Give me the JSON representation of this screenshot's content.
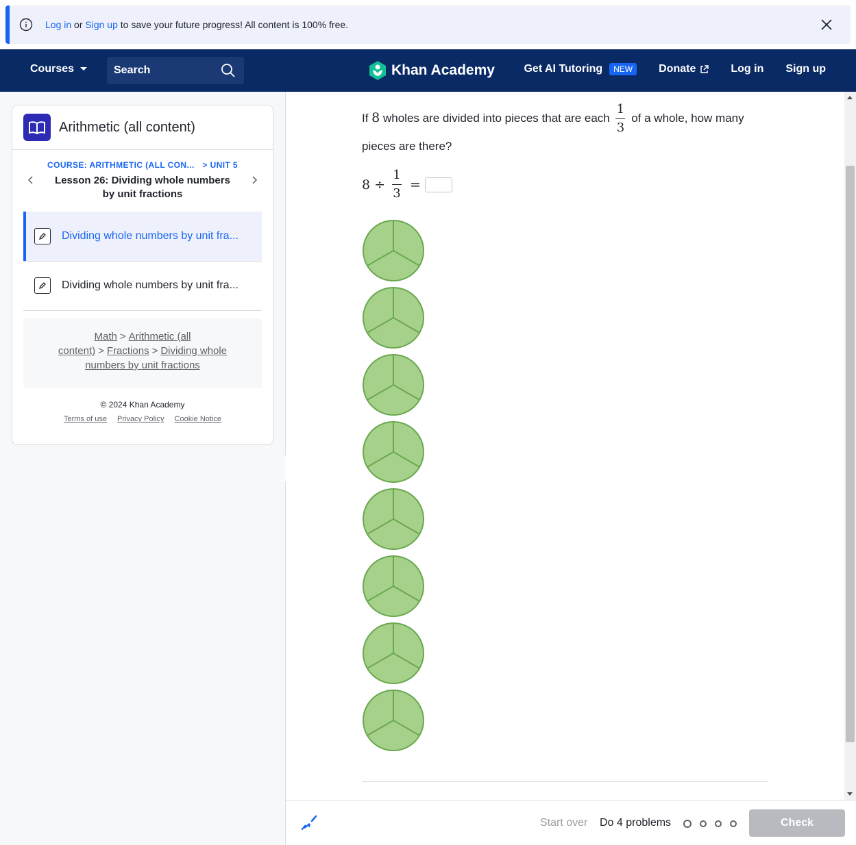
{
  "banner": {
    "login_link": "Log in",
    "or_text": " or ",
    "signup_link": "Sign up",
    "message": " to save your future progress! All content is 100% free."
  },
  "header": {
    "courses_label": "Courses",
    "search_placeholder": "Search",
    "logo_text": "Khan Academy",
    "ai_tutoring_label": "Get AI Tutoring",
    "new_badge": "NEW",
    "donate_label": "Donate",
    "login_label": "Log in",
    "signup_label": "Sign up"
  },
  "sidebar": {
    "course_title": "Arithmetic (all content)",
    "lesson_crumb_course": "COURSE: ARITHMETIC (ALL CON...",
    "lesson_crumb_unit": "> UNIT 5",
    "lesson_title": "Lesson 26: Dividing whole numbers by unit fractions",
    "exercises": [
      {
        "label": "Dividing whole numbers by unit fra...",
        "active": true
      },
      {
        "label": "Dividing whole numbers by unit fra...",
        "active": false
      }
    ],
    "breadcrumb": [
      "Math",
      "Arithmetic (all content)",
      "Fractions",
      "Dividing whole numbers by unit fractions"
    ],
    "breadcrumb_sep": ">",
    "copyright": "© 2024 Khan Academy",
    "footer_links": [
      "Terms of use",
      "Privacy Policy",
      "Cookie Notice"
    ]
  },
  "question": {
    "text_before": "If ",
    "whole_count": "8",
    "text_middle": " wholes are divided into pieces that are each ",
    "frac_num": "1",
    "frac_den": "3",
    "text_after": " of a whole, how many pieces are there?",
    "equation_left": "8",
    "divide_sign": "÷",
    "equals_sign": "=",
    "answer_value": "",
    "circle_count": 8,
    "circle_fill": "#a6d18a",
    "circle_stroke": "#6aa84f"
  },
  "bottom_bar": {
    "start_over": "Start over",
    "do_problems": "Do 4 problems",
    "check_label": "Check",
    "progress_dots": 4
  },
  "colors": {
    "header_bg": "#0a2a66",
    "accent": "#1865f2",
    "logo_green": "#14bf96"
  }
}
